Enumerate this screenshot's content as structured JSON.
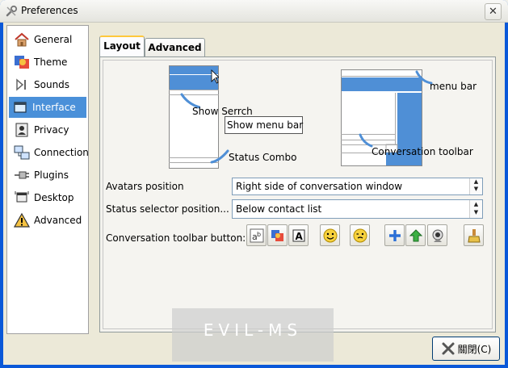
{
  "window": {
    "title": "Preferences",
    "close_glyph": "✕"
  },
  "sidebar": {
    "items": [
      {
        "label": "General",
        "icon": "home-icon"
      },
      {
        "label": "Theme",
        "icon": "theme-icon"
      },
      {
        "label": "Sounds",
        "icon": "sound-icon"
      },
      {
        "label": "Interface",
        "icon": "interface-icon",
        "selected": true
      },
      {
        "label": "Privacy",
        "icon": "privacy-icon"
      },
      {
        "label": "Connection",
        "icon": "connection-icon"
      },
      {
        "label": "Plugins",
        "icon": "plugin-icon"
      },
      {
        "label": "Desktop",
        "icon": "desktop-icon"
      },
      {
        "label": "Advanced",
        "icon": "warning-icon"
      }
    ]
  },
  "tabs": {
    "layout": "Layout",
    "advanced": "Advanced",
    "active": "Layout"
  },
  "preview": {
    "show_menu_bar": "Show menu bar",
    "show_search": "Show Serrch",
    "status_combo": "Status Combo",
    "menu_bar": "menu bar",
    "conversation_toolbar": "Conversation toolbar"
  },
  "form": {
    "avatars_label": "Avatars position",
    "avatars_value": "Right side of conversation window",
    "status_label": "Status selector position...",
    "status_value": "Below contact list",
    "toolbar_label": "Conversation toolbar button:"
  },
  "toolbar_buttons": [
    {
      "icon": "font-icon"
    },
    {
      "icon": "color-icon"
    },
    {
      "icon": "text-format-icon"
    },
    {
      "icon": "smiley-icon"
    },
    {
      "icon": "wink-icon"
    },
    {
      "icon": "add-icon"
    },
    {
      "icon": "send-file-icon"
    },
    {
      "icon": "webcam-icon"
    },
    {
      "icon": "clear-icon"
    }
  ],
  "watermark": "EVIL-MS",
  "close_button": "關閉(C)",
  "colors": {
    "accent": "#4a90d9",
    "preview_blue": "#4f8fd6"
  }
}
